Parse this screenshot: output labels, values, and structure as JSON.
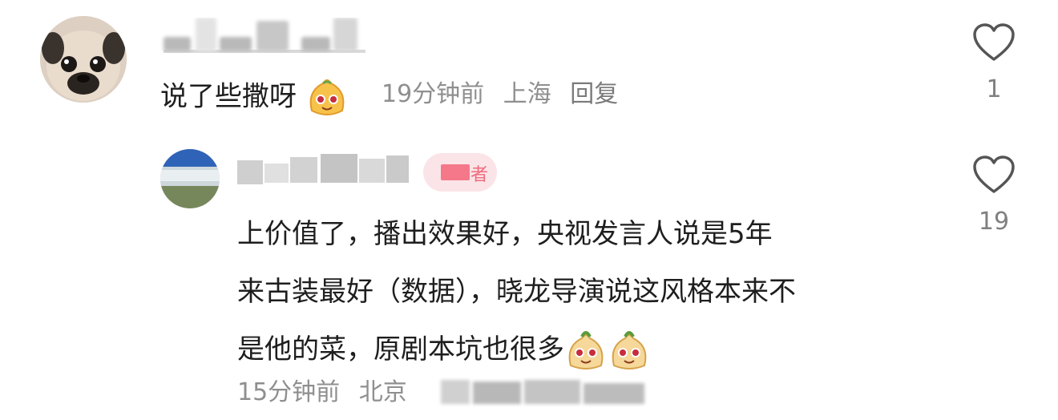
{
  "comments": [
    {
      "text": "说了些撒呀",
      "time": "19分钟前",
      "location": "上海",
      "reply_label": "回复",
      "like_count": "1"
    },
    {
      "text_lines": [
        "上价值了，播出效果好，央视发言人说是5年",
        "来古装最好（数据），晓龙导演说这风格本来不",
        "是他的菜，原剧本坑也很多"
      ],
      "badge_text": "者",
      "time": "15分钟前",
      "location": "北京",
      "like_count": "19"
    }
  ],
  "icons": {
    "like": "heart-outline-icon",
    "emoji": "smiling-dumpling-emoji-icon"
  },
  "colors": {
    "meta_text": "#8f8f8f",
    "badge_bg": "#fbe4e7",
    "badge_accent": "#f4788a"
  }
}
